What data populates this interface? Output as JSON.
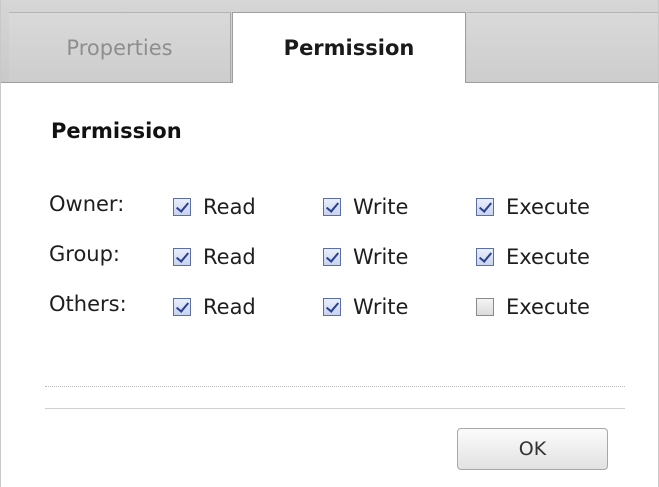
{
  "tabs": [
    {
      "label": "Properties",
      "active": false
    },
    {
      "label": "Permission",
      "active": true
    }
  ],
  "section_title": "Permission",
  "rows": [
    {
      "label": "Owner:",
      "read": {
        "label": "Read",
        "checked": true
      },
      "write": {
        "label": "Write",
        "checked": true
      },
      "execute": {
        "label": "Execute",
        "checked": true
      }
    },
    {
      "label": "Group:",
      "read": {
        "label": "Read",
        "checked": true
      },
      "write": {
        "label": "Write",
        "checked": true
      },
      "execute": {
        "label": "Execute",
        "checked": true
      }
    },
    {
      "label": "Others:",
      "read": {
        "label": "Read",
        "checked": true
      },
      "write": {
        "label": "Write",
        "checked": true
      },
      "execute": {
        "label": "Execute",
        "checked": false
      }
    }
  ],
  "ok_label": "OK",
  "colors": {
    "tab_bar": "#cccccc",
    "checkmark": "#2a3f8f",
    "active_tab_bg": "#ffffff"
  }
}
